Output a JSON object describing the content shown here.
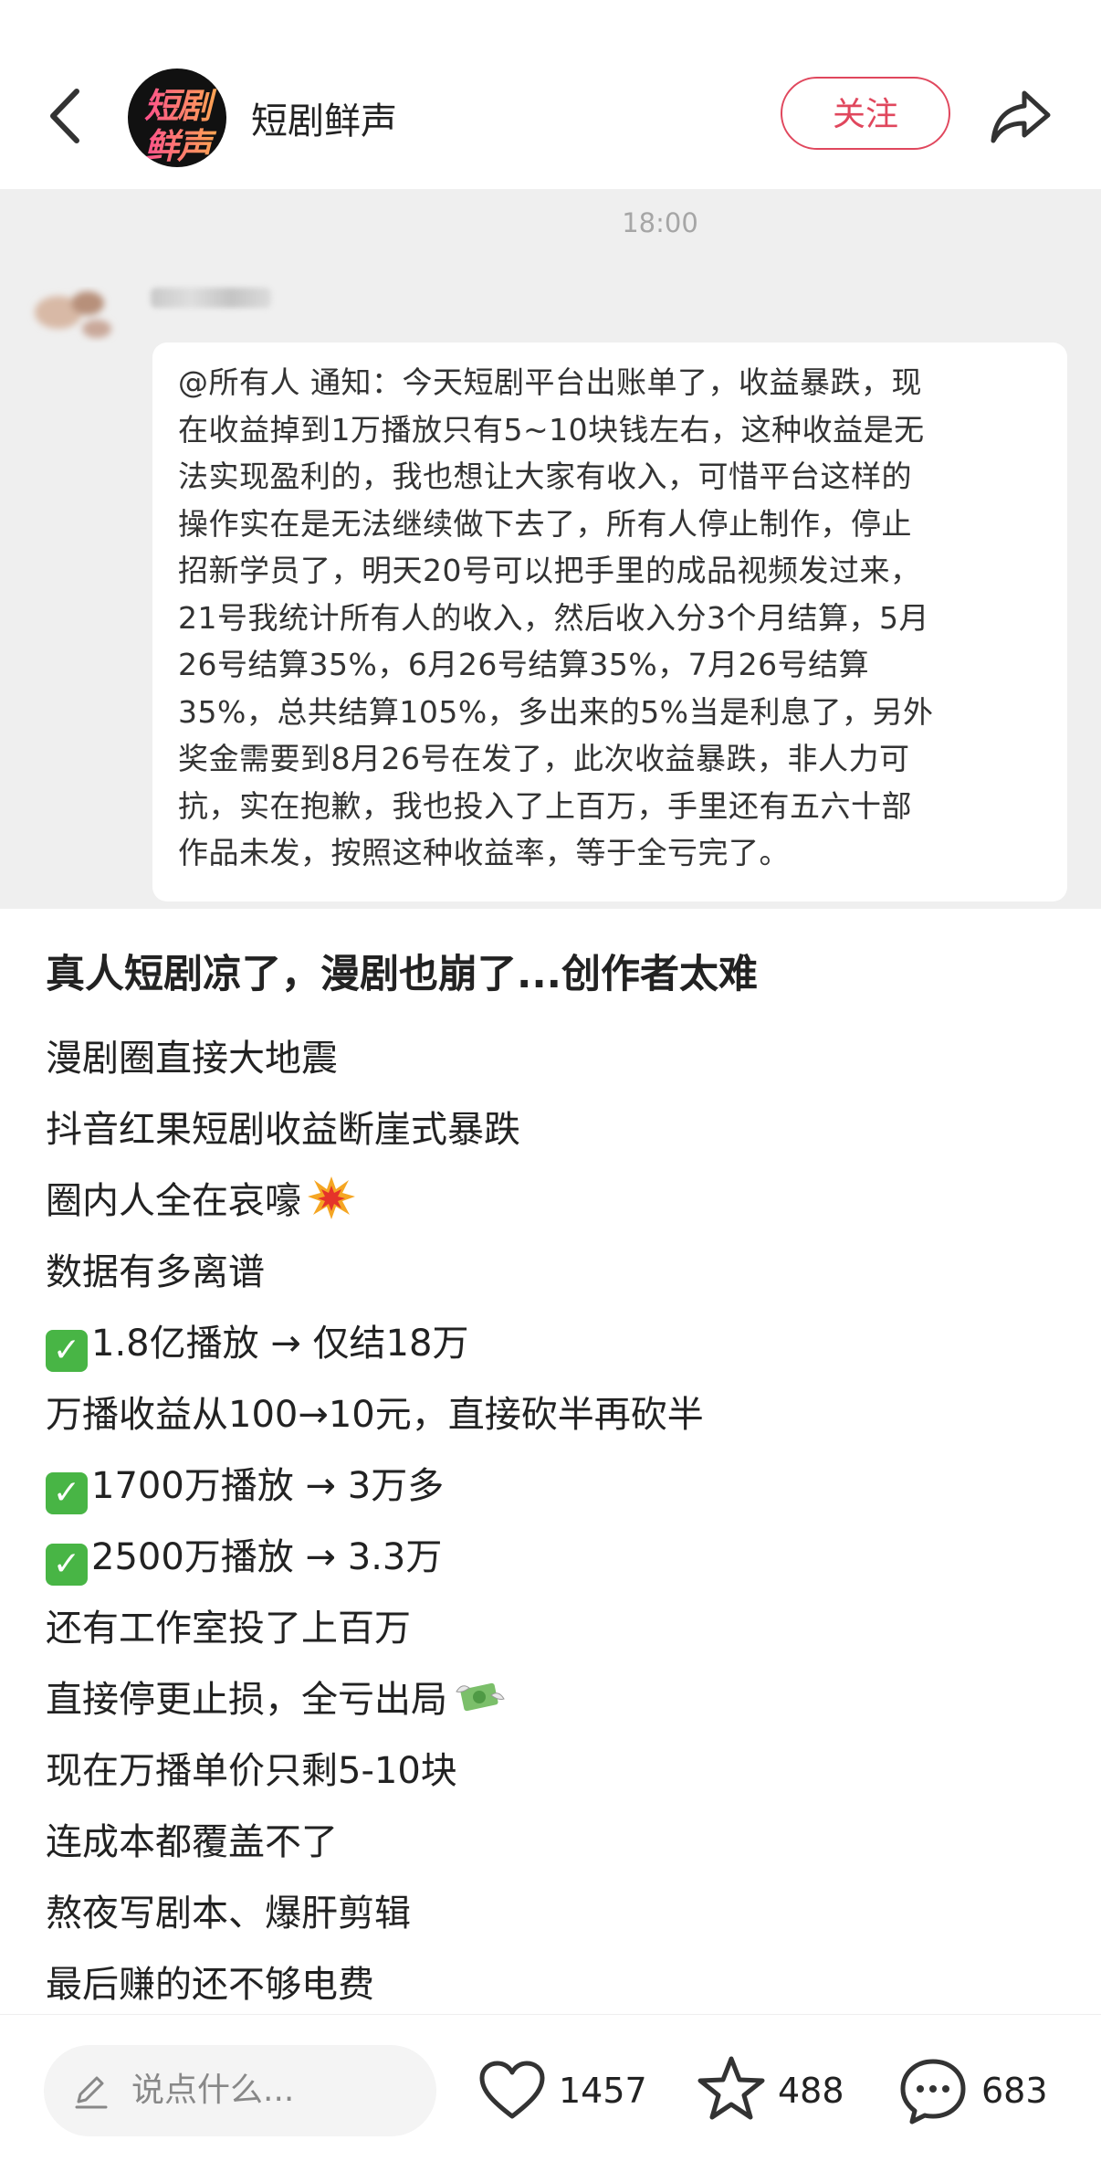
{
  "header": {
    "back_icon": "chevron-left-icon",
    "avatar_line1": "短剧",
    "avatar_line2": "鲜声",
    "account_name": "短剧鲜声",
    "follow_label": "关注",
    "share_icon": "share-arrow-icon"
  },
  "chat": {
    "time": "18:00",
    "message": "@所有人 通知：今天短剧平台出账单了，收益暴跌，现\n在收益掉到1万播放只有5~10块钱左右，这种收益是无\n法实现盈利的，我也想让大家有收入，可惜平台这样的\n操作实在是无法继续做下去了，所有人停止制作，停止\n招新学员了，明天20号可以把手里的成品视频发过来，\n21号我统计所有人的收入，然后收入分3个月结算，5月\n26号结算35%，6月26号结算35%，7月26号结算\n35%，总共结算105%，多出来的5%当是利息了，另外\n奖金需要到8月26号在发了，此次收益暴跌，非人力可\n抗，实在抱歉，我也投入了上百万，手里还有五六十部\n作品未发，按照这种收益率，等于全亏完了。"
  },
  "post": {
    "title": "真人短剧凉了，漫剧也崩了...创作者太难",
    "lines": [
      {
        "text": "漫剧圈直接大地震"
      },
      {
        "text": "抖音红果短剧收益断崖式暴跌"
      },
      {
        "text": "圈内人全在哀嚎",
        "emoji": "explosion-icon"
      },
      {
        "text": "数据有多离谱"
      },
      {
        "text": "1.8亿播放 → 仅结18万",
        "check": true
      },
      {
        "text": "万播收益从100→10元，直接砍半再砍半"
      },
      {
        "text": "1700万播放 → 3万多",
        "check": true
      },
      {
        "text": "2500万播放 → 3.3万",
        "check": true
      },
      {
        "text": "还有工作室投了上百万"
      },
      {
        "text": "直接停更止损，全亏出局",
        "emoji": "money-wings-icon"
      },
      {
        "text": "现在万播单价只剩5-10块"
      },
      {
        "text": "连成本都覆盖不了"
      },
      {
        "text": "熬夜写剧本、爆肝剪辑"
      },
      {
        "text": "最后赚的还不够电费"
      }
    ]
  },
  "bottom_bar": {
    "comment_placeholder": "说点什么...",
    "likes": "1457",
    "favorites": "488",
    "comments": "683"
  },
  "colors": {
    "accent": "#e0475d",
    "chat_bg": "#efefef",
    "check_green": "#48b545"
  }
}
